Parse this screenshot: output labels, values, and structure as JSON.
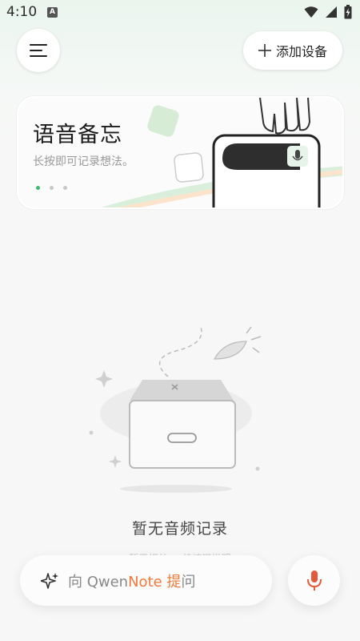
{
  "status_bar": {
    "time": "4:10",
    "app_icon_letter": "A"
  },
  "header": {
    "add_device_label": "添加设备"
  },
  "banner": {
    "title": "语音备忘",
    "subtitle": "长按即可记录想法。",
    "page_count": 3,
    "active_page": 1
  },
  "empty_state": {
    "message": "暂无音频记录",
    "hint": "··· 暂无相关 ··· 快捷键说明 ···"
  },
  "ask_bar": {
    "prefix": "向 Qwen",
    "brand_highlight": "Note",
    "suffix_highlight": " 提",
    "suffix": "问"
  },
  "colors": {
    "accent_green": "#3dbb6e",
    "accent_orange": "#f07a3a",
    "mic_red": "#e25a3c"
  },
  "icons": {
    "menu": "menu-icon",
    "add": "plus-icon",
    "sparkle": "sparkle-icon",
    "mic": "microphone-icon",
    "wifi": "wifi-icon",
    "signal": "signal-icon",
    "battery": "battery-icon"
  }
}
